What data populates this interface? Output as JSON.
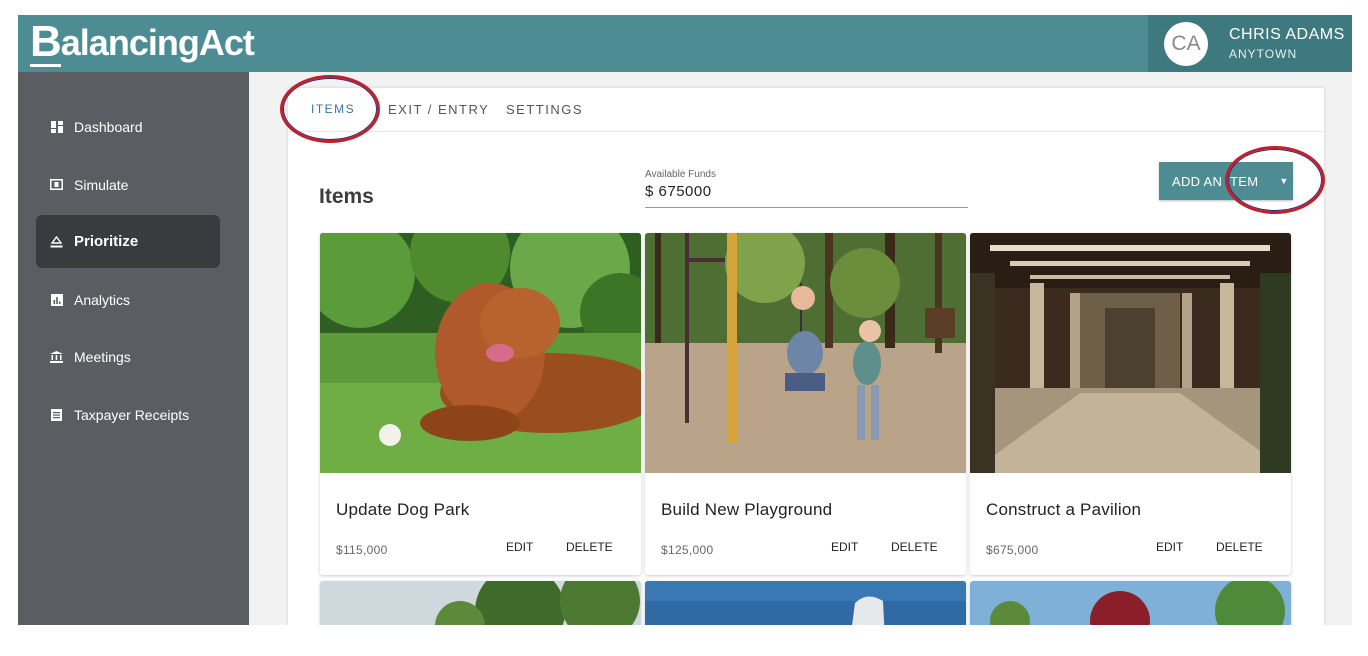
{
  "header": {
    "logo_initial": "B",
    "logo_rest": "alancingAct",
    "avatar_initials": "CA",
    "user_name": "CHRIS ADAMS",
    "user_location": "ANYTOWN"
  },
  "sidebar": {
    "items": [
      {
        "label": "Dashboard",
        "icon": "dashboard-icon"
      },
      {
        "label": "Simulate",
        "icon": "simulate-icon"
      },
      {
        "label": "Prioritize",
        "icon": "scale-icon",
        "active": true
      },
      {
        "label": "Analytics",
        "icon": "analytics-icon"
      },
      {
        "label": "Meetings",
        "icon": "meetings-icon"
      },
      {
        "label": "Taxpayer Receipts",
        "icon": "receipt-icon"
      }
    ]
  },
  "tabs": [
    {
      "label": "ITEMS",
      "active": true
    },
    {
      "label": "EXIT / ENTRY"
    },
    {
      "label": "SETTINGS"
    }
  ],
  "main": {
    "title": "Items",
    "funds_label": "Available Funds",
    "funds_value": "$ 675000",
    "add_button_label": "ADD AN ITEM",
    "add_button_caret": "▼"
  },
  "cards": [
    {
      "title": "Update Dog Park",
      "cost": "$115,000",
      "edit": "EDIT",
      "delete": "DELETE"
    },
    {
      "title": "Build New Playground",
      "cost": "$125,000",
      "edit": "EDIT",
      "delete": "DELETE"
    },
    {
      "title": "Construct a Pavilion",
      "cost": "$675,000",
      "edit": "EDIT",
      "delete": "DELETE"
    }
  ],
  "colors": {
    "brand": "#4d8c93",
    "sidebar": "#5b5d63",
    "sidebar_active": "#3a3b3f",
    "tab_active": "#3b6fb3",
    "highlight_ring": "#c0202a"
  }
}
